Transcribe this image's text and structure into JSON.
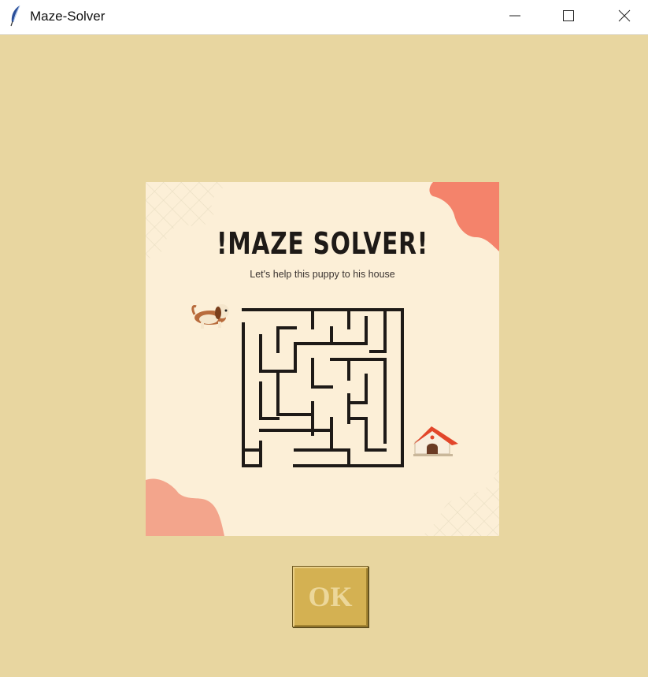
{
  "window": {
    "title": "Maze-Solver",
    "icon": "feather-icon",
    "controls": [
      "minimize-icon",
      "maximize-icon",
      "close-icon"
    ]
  },
  "banner": {
    "title": "!MAZE SOLVER!",
    "subtitle": "Let's help this puppy to his house",
    "icons": [
      "puppy-icon",
      "doghouse-icon"
    ]
  },
  "ok_button": {
    "label": "OK"
  },
  "colors": {
    "background": "#e8d6a0",
    "banner": "#fcefd7",
    "accent": "#f4836b",
    "button": "#d4b152",
    "button_text": "#ecd79a"
  }
}
